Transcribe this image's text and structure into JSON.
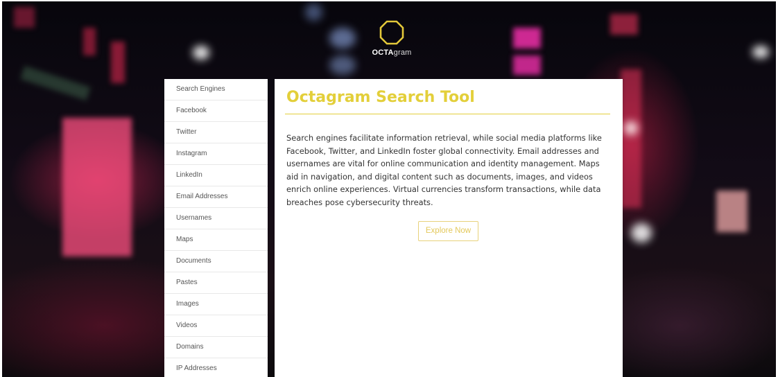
{
  "brand": {
    "logo_bold": "OCTA",
    "logo_thin": "gram",
    "accent": "#e3cf3a"
  },
  "sidebar": {
    "items": [
      {
        "label": "Search Engines"
      },
      {
        "label": "Facebook"
      },
      {
        "label": "Twitter"
      },
      {
        "label": "Instagram"
      },
      {
        "label": "LinkedIn"
      },
      {
        "label": "Email Addresses"
      },
      {
        "label": "Usernames"
      },
      {
        "label": "Maps"
      },
      {
        "label": "Documents"
      },
      {
        "label": "Pastes"
      },
      {
        "label": "Images"
      },
      {
        "label": "Videos"
      },
      {
        "label": "Domains"
      },
      {
        "label": "IP Addresses"
      }
    ]
  },
  "main": {
    "title": "Octagram Search Tool",
    "description": "Search engines facilitate information retrieval, while social media platforms like Facebook, Twitter, and LinkedIn foster global connectivity. Email addresses and usernames are vital for online communication and identity management. Maps aid in navigation, and digital content such as documents, images, and videos enrich online experiences. Virtual currencies transform transactions, while data breaches pose cybersecurity threats.",
    "button_label": "Explore Now"
  },
  "icons": {
    "logo": "octagon-logo-icon"
  }
}
